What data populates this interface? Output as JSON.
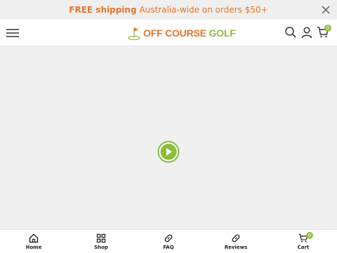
{
  "announcement": {
    "bold": "FREE shipping",
    "text": "Australia-wide on orders $50+"
  },
  "header": {
    "logo_part1": "OFF COURSE ",
    "logo_part2": "GOLF",
    "cart_count": "0"
  },
  "bottom_nav": {
    "items": [
      {
        "label": "Home",
        "icon": "home-icon"
      },
      {
        "label": "Shop",
        "icon": "grid-icon"
      },
      {
        "label": "FAQ",
        "icon": "link-icon"
      },
      {
        "label": "Reviews",
        "icon": "link-icon"
      },
      {
        "label": "Cart",
        "icon": "cart-icon"
      }
    ],
    "cart_count": "0"
  },
  "colors": {
    "accent_orange": "#e8752b",
    "accent_green": "#8bbf3a"
  }
}
